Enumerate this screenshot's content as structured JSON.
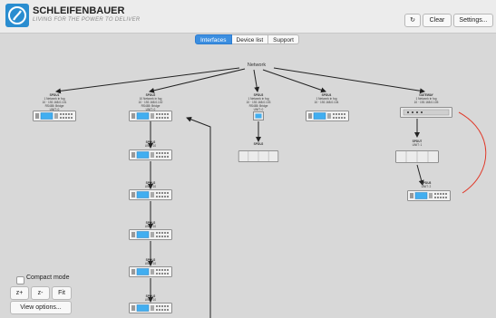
{
  "header": {
    "brand": "SCHLEIFENBAUER",
    "tagline": "LIVING FOR THE POWER TO DELIVER",
    "refresh_icon": "↻",
    "clear_label": "Clear",
    "settings_label": "Settings..."
  },
  "tabs": [
    {
      "label": "Interfaces",
      "active": true
    },
    {
      "label": "Device list",
      "active": false
    },
    {
      "label": "Support",
      "active": false
    }
  ],
  "diagram": {
    "root_label": "Network",
    "nodes": [
      {
        "lines": [
          "SPDU1",
          "1 Network in fog",
          "10 · 192.168.0.101",
          "RS485: Bridge",
          "UNIT: 0"
        ]
      },
      {
        "lines": [
          "SPDU2",
          "10 Network in fog",
          "10 · 192.168.0.102",
          "RS485: Bridge",
          "UNIT: 0"
        ]
      },
      {
        "lines": [
          "SPDU3",
          "1 Network in fog",
          "10 · 192.168.0.103",
          "RS485: Bridge",
          "UNIT: 0"
        ]
      },
      {
        "lines": [
          "SPDU4",
          "1 Network in fog",
          "10 · 192.168.0.104"
        ]
      },
      {
        "lines": [
          "GATEWAY",
          "1 Network in fog",
          "10 · 192.168.0.105"
        ]
      }
    ],
    "chain_label": "SPDU2",
    "chain_sub": "UNIT: 10",
    "gateway_children": [
      {
        "lines": [
          "SPDU7",
          "UNIT: 1"
        ]
      },
      {
        "lines": [
          "SPDU8",
          "UNIT: 2"
        ]
      },
      {
        "lines": [
          "SPDU9",
          "UNIT: 3"
        ]
      }
    ]
  },
  "controls": {
    "compact_mode_label": "Compact mode",
    "zoom_in_label": "z+",
    "zoom_out_label": "z-",
    "fit_label": "Fit",
    "view_options_label": "View options..."
  },
  "colors": {
    "accent": "#3b8ee0",
    "link_red": "#e03a2a",
    "canvas": "#d8d8d8"
  }
}
